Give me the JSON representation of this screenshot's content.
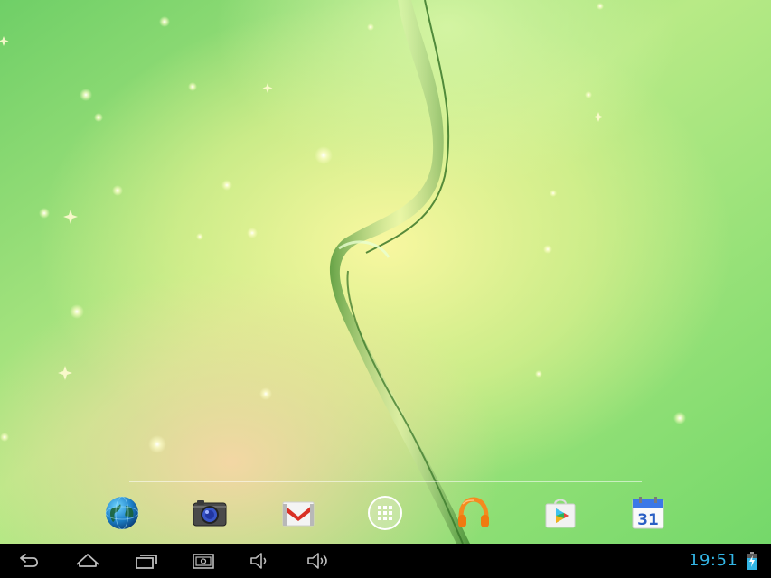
{
  "status_bar": {
    "clock": "19:51",
    "battery_icon": "battery-charging-icon"
  },
  "dock": {
    "apps": [
      {
        "name": "browser",
        "icon": "globe-icon"
      },
      {
        "name": "camera",
        "icon": "camera-icon"
      },
      {
        "name": "gmail",
        "icon": "gmail-icon"
      },
      {
        "name": "all-apps",
        "icon": "app-drawer-icon"
      },
      {
        "name": "play-music",
        "icon": "headphones-icon"
      },
      {
        "name": "play-store",
        "icon": "play-store-icon"
      },
      {
        "name": "calendar",
        "icon": "calendar-icon",
        "label": "31"
      }
    ]
  },
  "navigation": {
    "buttons": [
      "back-icon",
      "home-icon",
      "recents-icon",
      "screenshot-icon",
      "volume-down-icon",
      "volume-up-icon"
    ]
  },
  "colors": {
    "accent": "#33b5e5",
    "navbar": "#000000",
    "wallpaper_green": "#7fd56a",
    "wallpaper_yellow": "#f4f38a"
  }
}
